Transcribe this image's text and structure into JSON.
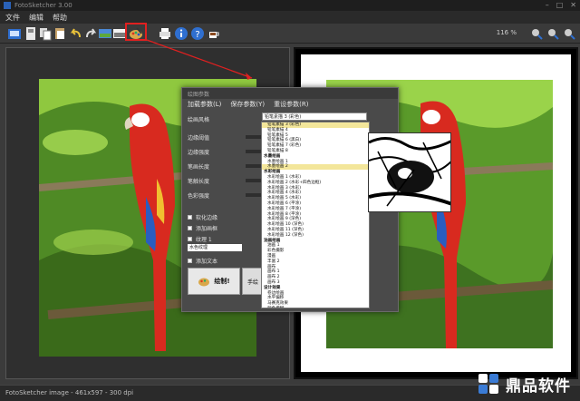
{
  "window": {
    "title": "FotoSketcher 3.00",
    "controls": [
      "–",
      "□",
      "✕"
    ]
  },
  "menubar": {
    "items": [
      "文件",
      "编辑",
      "帮助"
    ]
  },
  "toolbar": {
    "icons": [
      "open-icon",
      "save-icon",
      "copy-icon",
      "paste-icon",
      "undo-icon",
      "redo-icon",
      "original-image-icon",
      "result-image-icon",
      "paint-palette-icon",
      "print-icon",
      "info-icon",
      "help-icon",
      "coffee-icon",
      "zoom-in-icon",
      "zoom-out-icon",
      "fit-icon"
    ],
    "zoom": "116 %",
    "highlight_color": "#e02020"
  },
  "dialog": {
    "title": "绘图参数",
    "menu": [
      "加载参数(L)",
      "保存参数(Y)",
      "重设参数(R)"
    ],
    "labels": {
      "style": "绘画风格",
      "threshold": "边缘阈值",
      "edge_intensity": "边缘强度",
      "stroke_length": "笔画长度",
      "paper_texture": "笔触长度",
      "color_intensity": "色彩强度",
      "soft_edge": "软化边缘",
      "add_frame": "添加画框",
      "texture": "纹理 1",
      "texture_value": "水色纹理",
      "add_text": "添加文本",
      "draw_button": "绘制!",
      "manual_button": "手绘"
    },
    "selected_style": "铅笔素描 3 (彩色)"
  },
  "dropdown": {
    "items": [
      {
        "t": "铅笔素描 3 (彩色)",
        "k": "sel"
      },
      {
        "t": "铅笔素描 4",
        "k": ""
      },
      {
        "t": "铅笔素描 5",
        "k": ""
      },
      {
        "t": "铅笔素描 6 (黑白)",
        "k": ""
      },
      {
        "t": "铅笔素描 7 (彩色)",
        "k": ""
      },
      {
        "t": "铅笔素描 8",
        "k": ""
      },
      {
        "t": "水墨绘画",
        "k": "cat"
      },
      {
        "t": "水墨绘画 1",
        "k": ""
      },
      {
        "t": "水墨绘画 2",
        "k": "sel"
      },
      {
        "t": "水彩绘画",
        "k": "cat"
      },
      {
        "t": "水彩绘画 1 (水彩)",
        "k": ""
      },
      {
        "t": "水彩绘画 2 (水彩+四色边框)",
        "k": ""
      },
      {
        "t": "水彩绘画 3 (水彩)",
        "k": ""
      },
      {
        "t": "水彩绘画 4 (水彩)",
        "k": ""
      },
      {
        "t": "水彩绘画 5 (水彩)",
        "k": ""
      },
      {
        "t": "水彩绘画 6 (平涂)",
        "k": ""
      },
      {
        "t": "水彩绘画 7 (平涂)",
        "k": ""
      },
      {
        "t": "水彩绘画 8 (平涂)",
        "k": ""
      },
      {
        "t": "水彩绘画 9 (深色)",
        "k": ""
      },
      {
        "t": "水彩绘画 10 (深色)",
        "k": ""
      },
      {
        "t": "水彩绘画 11 (深色)",
        "k": ""
      },
      {
        "t": "水彩绘画 12 (深色)",
        "k": ""
      },
      {
        "t": "油画绘画",
        "k": "cat"
      },
      {
        "t": "油画 1",
        "k": ""
      },
      {
        "t": "彩色摄影",
        "k": ""
      },
      {
        "t": "漫画",
        "k": ""
      },
      {
        "t": "丰富 2",
        "k": ""
      },
      {
        "t": "画布",
        "k": ""
      },
      {
        "t": "画布 1",
        "k": ""
      },
      {
        "t": "画布 2",
        "k": ""
      },
      {
        "t": "画布 3",
        "k": ""
      },
      {
        "t": "设计效果",
        "k": "cat"
      },
      {
        "t": "卷边绘画",
        "k": ""
      },
      {
        "t": "水平偏移",
        "k": ""
      },
      {
        "t": "马赛克效果",
        "k": ""
      },
      {
        "t": "颜色模糊",
        "k": ""
      },
      {
        "t": "其他效果",
        "k": "cat"
      },
      {
        "t": "只改变画板大小",
        "k": ""
      }
    ]
  },
  "status": "FotoSketcher image - 461x597 - 300 dpi",
  "watermark": {
    "text": "鼎品软件",
    "mark_color": "#3a7bd5"
  }
}
